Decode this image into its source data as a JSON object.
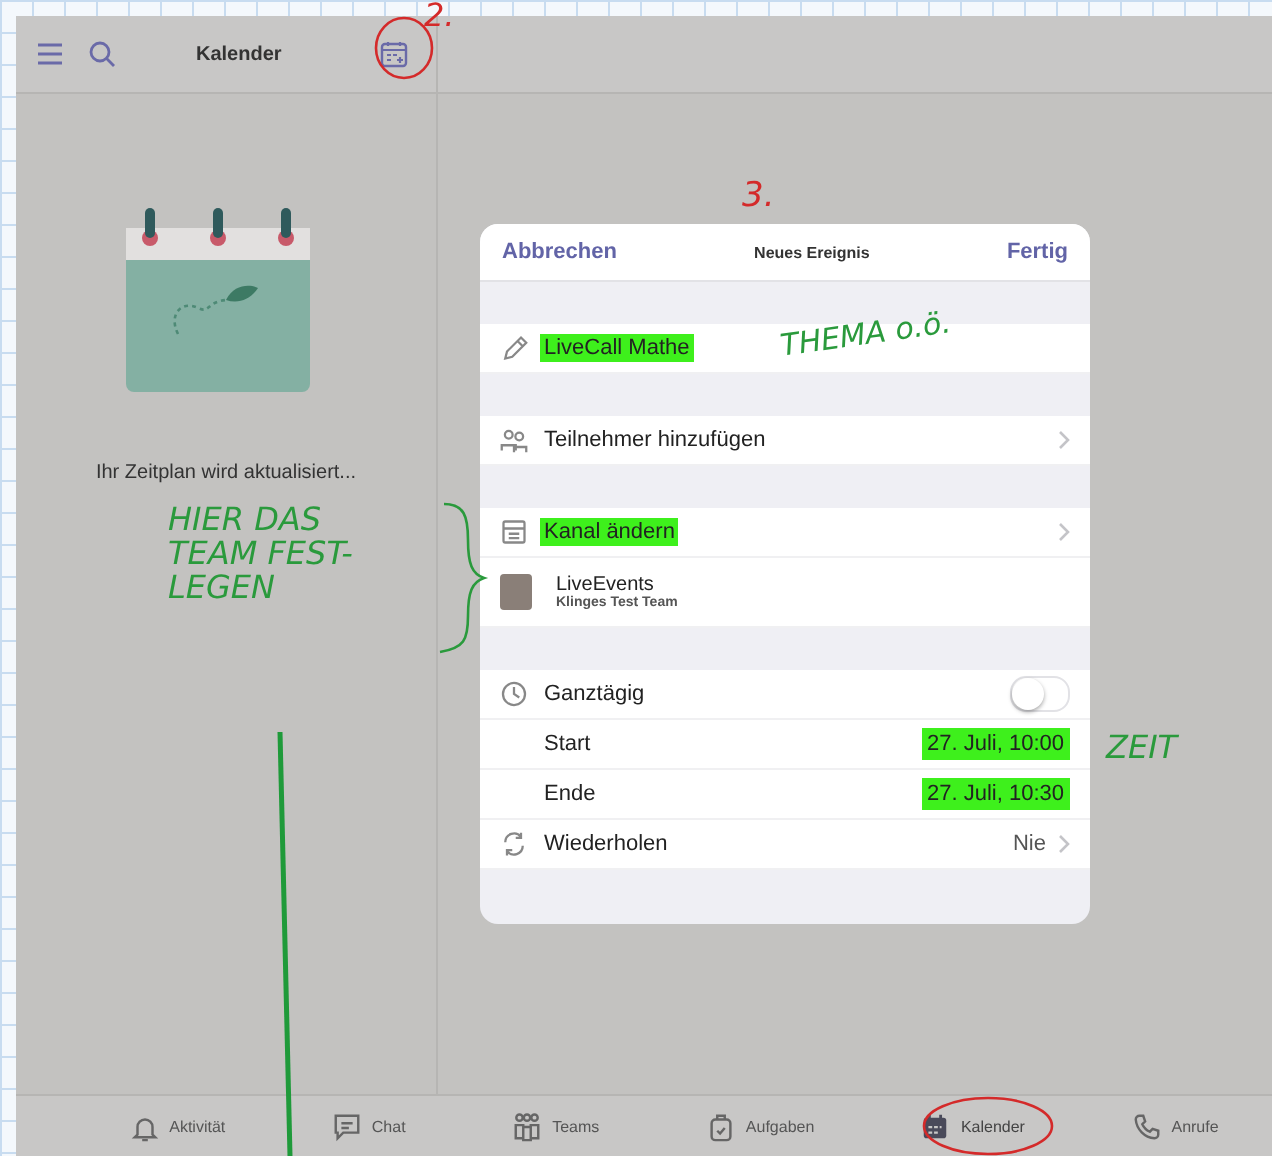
{
  "top_bar": {
    "title": "Kalender"
  },
  "left_pane": {
    "message": "Ihr Zeitplan wird aktualisiert..."
  },
  "dialog": {
    "cancel": "Abbrechen",
    "title": "Neues Ereignis",
    "done": "Fertig",
    "rows": [
      {
        "kind": "gap"
      },
      {
        "kind": "title",
        "label": "LiveCall Mathe",
        "highlighted": true
      },
      {
        "kind": "gap"
      },
      {
        "kind": "link",
        "label": "Teilnehmer hinzufügen",
        "highlighted": false
      },
      {
        "kind": "gap"
      },
      {
        "kind": "link",
        "label": "Kanal ändern",
        "highlighted": true
      },
      {
        "kind": "team",
        "name": "LiveEvents",
        "team": "Klinges Test Team"
      },
      {
        "kind": "gap"
      },
      {
        "kind": "toggle",
        "label": "Ganztägig",
        "on": false
      },
      {
        "kind": "value",
        "label": "Start",
        "value": "27. Juli, 10:00",
        "highlighted": true
      },
      {
        "kind": "value",
        "label": "Ende",
        "value": "27. Juli, 10:30",
        "highlighted": true
      },
      {
        "kind": "link",
        "label": "Wiederholen",
        "value": "Nie",
        "highlighted": false
      },
      {
        "kind": "gap"
      }
    ]
  },
  "tab_bar": [
    {
      "label": "Aktivität",
      "selected": false
    },
    {
      "label": "Chat",
      "selected": false
    },
    {
      "label": "Teams",
      "selected": false
    },
    {
      "label": "Aufgaben",
      "selected": false
    },
    {
      "label": "Kalender",
      "selected": true
    },
    {
      "label": "Anrufe",
      "selected": false
    }
  ],
  "annotations": [
    {
      "lines": [
        "2."
      ],
      "color": "#d42a2a"
    },
    {
      "lines": [
        "3."
      ],
      "color": "#d42a2a"
    },
    {
      "lines": [
        "THEMA o.ö."
      ],
      "color": "#2a9a3c"
    },
    {
      "lines": [
        "HIER DAS",
        "TEAM FEST-",
        "LEGEN"
      ],
      "color": "#2a9a3c"
    },
    {
      "lines": [
        "ZEIT"
      ],
      "color": "#2a9a3c"
    }
  ]
}
